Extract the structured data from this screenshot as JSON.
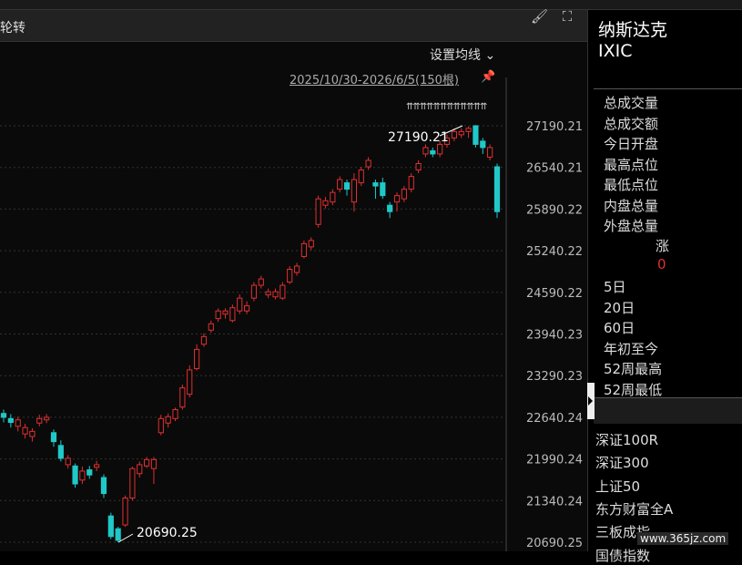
{
  "header": {
    "title": "轮转",
    "setma_label": "设置均线",
    "range_label": "2025/10/30-2026/6/5(150根)"
  },
  "chart_data": {
    "type": "candlestick",
    "y_ticks": [
      "27190.21",
      "26540.21",
      "25890.22",
      "25240.22",
      "24590.22",
      "23940.23",
      "23290.23",
      "22640.24",
      "21990.24",
      "21340.24",
      "20690.25"
    ],
    "ylim": [
      20690.25,
      27190.21
    ],
    "annotations": {
      "high": "27190.21",
      "low": "20690.25"
    },
    "candles": [
      [
        22700,
        22640,
        22760,
        22560
      ],
      [
        22620,
        22560,
        22690,
        22480
      ],
      [
        22500,
        22600,
        22650,
        22420
      ],
      [
        22380,
        22480,
        22540,
        22310
      ],
      [
        22340,
        22420,
        22470,
        22260
      ],
      [
        22550,
        22620,
        22680,
        22500
      ],
      [
        22600,
        22640,
        22690,
        22550
      ],
      [
        22400,
        22260,
        22450,
        22180
      ],
      [
        22200,
        22000,
        22280,
        21950
      ],
      [
        21900,
        22000,
        22050,
        21840
      ],
      [
        21880,
        21600,
        21920,
        21540
      ],
      [
        21660,
        21800,
        21870,
        21600
      ],
      [
        21820,
        21740,
        21880,
        21680
      ],
      [
        21860,
        21900,
        21960,
        21800
      ],
      [
        21700,
        21450,
        21750,
        21380
      ],
      [
        21100,
        20780,
        21150,
        20740
      ],
      [
        20900,
        20720,
        20930,
        20690
      ],
      [
        20960,
        21380,
        21420,
        20930
      ],
      [
        21380,
        21840,
        21870,
        21340
      ],
      [
        21760,
        21900,
        21950,
        21700
      ],
      [
        21880,
        21980,
        22020,
        21850
      ],
      [
        21840,
        21980,
        22020,
        21600
      ],
      [
        22400,
        22620,
        22680,
        22360
      ],
      [
        22550,
        22650,
        22700,
        22480
      ],
      [
        22620,
        22760,
        22790,
        22580
      ],
      [
        22800,
        23100,
        23150,
        22760
      ],
      [
        23000,
        23380,
        23450,
        22950
      ],
      [
        23400,
        23700,
        23780,
        23370
      ],
      [
        23780,
        23900,
        23950,
        23740
      ],
      [
        24000,
        24100,
        24150,
        23960
      ],
      [
        24180,
        24300,
        24340,
        24130
      ],
      [
        24250,
        24300,
        24340,
        24180
      ],
      [
        24150,
        24350,
        24400,
        24120
      ],
      [
        24300,
        24500,
        24560,
        24250
      ],
      [
        24300,
        24380,
        24450,
        24250
      ],
      [
        24500,
        24700,
        24750,
        24450
      ],
      [
        24700,
        24800,
        24850,
        24650
      ],
      [
        24550,
        24600,
        24650,
        24500
      ],
      [
        24520,
        24600,
        24650,
        24480
      ],
      [
        24500,
        24700,
        24750,
        24470
      ],
      [
        24750,
        24950,
        25000,
        24720
      ],
      [
        24900,
        25000,
        25050,
        24850
      ],
      [
        25150,
        25350,
        25400,
        25120
      ],
      [
        25300,
        25400,
        25450,
        25250
      ],
      [
        25650,
        26050,
        26100,
        25600
      ],
      [
        25950,
        26020,
        26080,
        25900
      ],
      [
        26000,
        26150,
        26200,
        25950
      ],
      [
        26200,
        26350,
        26400,
        26150
      ],
      [
        26300,
        26200,
        26350,
        26100
      ],
      [
        26000,
        26350,
        26450,
        25850
      ],
      [
        26300,
        26500,
        26550,
        26250
      ],
      [
        26550,
        26650,
        26700,
        26500
      ],
      [
        26300,
        26250,
        26350,
        26050
      ],
      [
        26300,
        26100,
        26380,
        26050
      ],
      [
        25950,
        25850,
        26000,
        25750
      ],
      [
        26000,
        26100,
        26150,
        25850
      ],
      [
        26050,
        26200,
        26250,
        26000
      ],
      [
        26200,
        26400,
        26450,
        26150
      ],
      [
        26500,
        26600,
        26650,
        26450
      ],
      [
        26750,
        26850,
        26900,
        26700
      ],
      [
        26800,
        26750,
        26850,
        26700
      ],
      [
        26750,
        26900,
        26950,
        26700
      ],
      [
        26900,
        27000,
        27050,
        26850
      ],
      [
        27000,
        27100,
        27150,
        26950
      ],
      [
        27050,
        27100,
        27150,
        27000
      ],
      [
        27100,
        27150,
        27180,
        27000
      ],
      [
        27190,
        26900,
        27200,
        26850
      ],
      [
        26950,
        26850,
        27000,
        26750
      ],
      [
        26700,
        26850,
        26900,
        26650
      ],
      [
        26550,
        25850,
        26600,
        25750
      ]
    ]
  },
  "sidebar": {
    "title": "纳斯达克",
    "code": "IXIC",
    "fields": [
      "总成交量",
      "总成交额",
      "今日开盘",
      "最高点位",
      "最低点位",
      "内盘总量",
      "外盘总量"
    ],
    "change_label": "涨",
    "change_value": "0",
    "periods": [
      "5日",
      "20日",
      "60日",
      "年初至今",
      "52周最高",
      "52周最低"
    ],
    "indices": [
      "深证100R",
      "深证300",
      "上证50",
      "东方财富全A",
      "三板成指",
      "国债指数"
    ]
  },
  "watermark": "www.365jz.com",
  "colors": {
    "up": "#e03030",
    "down": "#20c8c8",
    "grid": "#333333"
  }
}
